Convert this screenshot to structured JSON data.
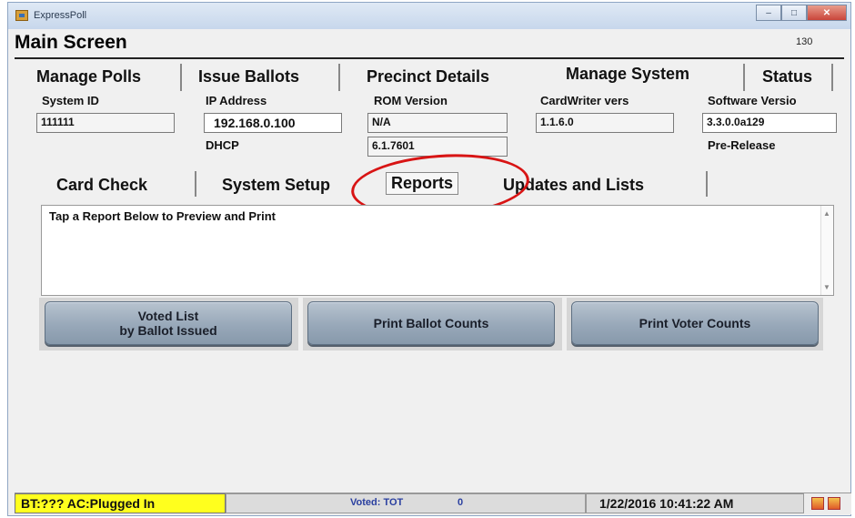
{
  "window": {
    "title": "ExpressPoll",
    "controls": {
      "minimize": "–",
      "maximize": "□",
      "close": "✕"
    }
  },
  "screen": {
    "title": "Main Screen",
    "number": "130"
  },
  "top_tabs": [
    "Manage Polls",
    "Issue Ballots",
    "Precinct Details",
    "Manage System",
    "Status"
  ],
  "system_info": {
    "system_id_label": "System ID",
    "system_id": "111111",
    "ip_label": "IP Address",
    "ip": "192.168.0.100",
    "dhcp_label": "DHCP",
    "rom_label": "ROM Version",
    "rom": "N/A",
    "os_version": "6.1.7601",
    "cardwriter_label": "CardWriter vers",
    "cardwriter": "1.1.6.0",
    "software_label": "Software Versio",
    "software": "3.3.0.0a129",
    "release": "Pre-Release"
  },
  "sub_tabs": [
    "Card Check",
    "System Setup",
    "Reports",
    "Updates and Lists"
  ],
  "active_sub_tab": "Reports",
  "report_area": {
    "text": "Tap a Report Below to Preview and Print"
  },
  "buttons": {
    "voted_list_line1": "Voted List",
    "voted_list_line2": "by Ballot Issued",
    "ballot_counts": "Print Ballot Counts",
    "voter_counts": "Print Voter Counts"
  },
  "status_bar": {
    "power": "BT:??? AC:Plugged In",
    "voted_label": "Voted:  TOT",
    "voted_value": "0",
    "datetime": "1/22/2016 10:41:22 AM"
  },
  "colors": {
    "power_bg": "#ffff1e",
    "highlight": "#d81414",
    "voted_text": "#2a3fa0"
  }
}
